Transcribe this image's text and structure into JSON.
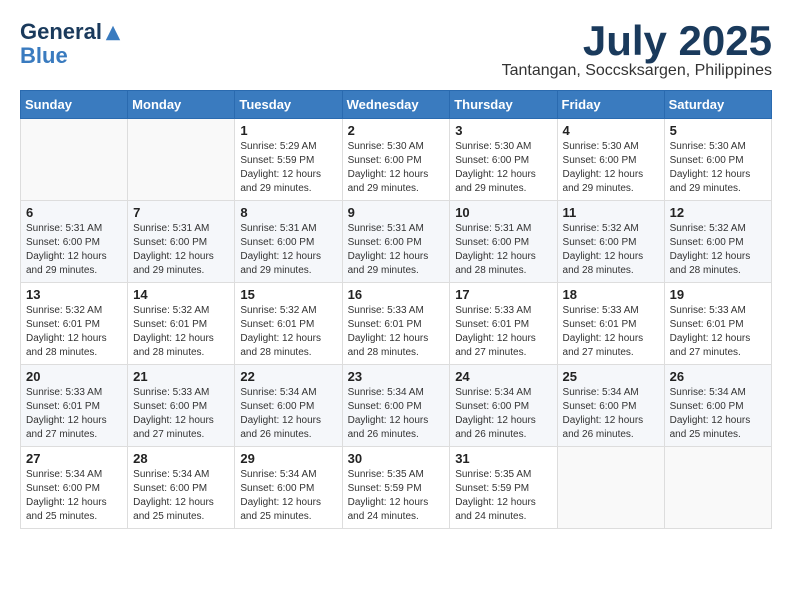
{
  "header": {
    "logo_line1": "General",
    "logo_line2": "Blue",
    "month_title": "July 2025",
    "location": "Tantangan, Soccsksargen, Philippines"
  },
  "weekdays": [
    "Sunday",
    "Monday",
    "Tuesday",
    "Wednesday",
    "Thursday",
    "Friday",
    "Saturday"
  ],
  "weeks": [
    [
      {
        "day": "",
        "info": ""
      },
      {
        "day": "",
        "info": ""
      },
      {
        "day": "1",
        "info": "Sunrise: 5:29 AM\nSunset: 5:59 PM\nDaylight: 12 hours and 29 minutes."
      },
      {
        "day": "2",
        "info": "Sunrise: 5:30 AM\nSunset: 6:00 PM\nDaylight: 12 hours and 29 minutes."
      },
      {
        "day": "3",
        "info": "Sunrise: 5:30 AM\nSunset: 6:00 PM\nDaylight: 12 hours and 29 minutes."
      },
      {
        "day": "4",
        "info": "Sunrise: 5:30 AM\nSunset: 6:00 PM\nDaylight: 12 hours and 29 minutes."
      },
      {
        "day": "5",
        "info": "Sunrise: 5:30 AM\nSunset: 6:00 PM\nDaylight: 12 hours and 29 minutes."
      }
    ],
    [
      {
        "day": "6",
        "info": "Sunrise: 5:31 AM\nSunset: 6:00 PM\nDaylight: 12 hours and 29 minutes."
      },
      {
        "day": "7",
        "info": "Sunrise: 5:31 AM\nSunset: 6:00 PM\nDaylight: 12 hours and 29 minutes."
      },
      {
        "day": "8",
        "info": "Sunrise: 5:31 AM\nSunset: 6:00 PM\nDaylight: 12 hours and 29 minutes."
      },
      {
        "day": "9",
        "info": "Sunrise: 5:31 AM\nSunset: 6:00 PM\nDaylight: 12 hours and 29 minutes."
      },
      {
        "day": "10",
        "info": "Sunrise: 5:31 AM\nSunset: 6:00 PM\nDaylight: 12 hours and 28 minutes."
      },
      {
        "day": "11",
        "info": "Sunrise: 5:32 AM\nSunset: 6:00 PM\nDaylight: 12 hours and 28 minutes."
      },
      {
        "day": "12",
        "info": "Sunrise: 5:32 AM\nSunset: 6:00 PM\nDaylight: 12 hours and 28 minutes."
      }
    ],
    [
      {
        "day": "13",
        "info": "Sunrise: 5:32 AM\nSunset: 6:01 PM\nDaylight: 12 hours and 28 minutes."
      },
      {
        "day": "14",
        "info": "Sunrise: 5:32 AM\nSunset: 6:01 PM\nDaylight: 12 hours and 28 minutes."
      },
      {
        "day": "15",
        "info": "Sunrise: 5:32 AM\nSunset: 6:01 PM\nDaylight: 12 hours and 28 minutes."
      },
      {
        "day": "16",
        "info": "Sunrise: 5:33 AM\nSunset: 6:01 PM\nDaylight: 12 hours and 28 minutes."
      },
      {
        "day": "17",
        "info": "Sunrise: 5:33 AM\nSunset: 6:01 PM\nDaylight: 12 hours and 27 minutes."
      },
      {
        "day": "18",
        "info": "Sunrise: 5:33 AM\nSunset: 6:01 PM\nDaylight: 12 hours and 27 minutes."
      },
      {
        "day": "19",
        "info": "Sunrise: 5:33 AM\nSunset: 6:01 PM\nDaylight: 12 hours and 27 minutes."
      }
    ],
    [
      {
        "day": "20",
        "info": "Sunrise: 5:33 AM\nSunset: 6:01 PM\nDaylight: 12 hours and 27 minutes."
      },
      {
        "day": "21",
        "info": "Sunrise: 5:33 AM\nSunset: 6:00 PM\nDaylight: 12 hours and 27 minutes."
      },
      {
        "day": "22",
        "info": "Sunrise: 5:34 AM\nSunset: 6:00 PM\nDaylight: 12 hours and 26 minutes."
      },
      {
        "day": "23",
        "info": "Sunrise: 5:34 AM\nSunset: 6:00 PM\nDaylight: 12 hours and 26 minutes."
      },
      {
        "day": "24",
        "info": "Sunrise: 5:34 AM\nSunset: 6:00 PM\nDaylight: 12 hours and 26 minutes."
      },
      {
        "day": "25",
        "info": "Sunrise: 5:34 AM\nSunset: 6:00 PM\nDaylight: 12 hours and 26 minutes."
      },
      {
        "day": "26",
        "info": "Sunrise: 5:34 AM\nSunset: 6:00 PM\nDaylight: 12 hours and 25 minutes."
      }
    ],
    [
      {
        "day": "27",
        "info": "Sunrise: 5:34 AM\nSunset: 6:00 PM\nDaylight: 12 hours and 25 minutes."
      },
      {
        "day": "28",
        "info": "Sunrise: 5:34 AM\nSunset: 6:00 PM\nDaylight: 12 hours and 25 minutes."
      },
      {
        "day": "29",
        "info": "Sunrise: 5:34 AM\nSunset: 6:00 PM\nDaylight: 12 hours and 25 minutes."
      },
      {
        "day": "30",
        "info": "Sunrise: 5:35 AM\nSunset: 5:59 PM\nDaylight: 12 hours and 24 minutes."
      },
      {
        "day": "31",
        "info": "Sunrise: 5:35 AM\nSunset: 5:59 PM\nDaylight: 12 hours and 24 minutes."
      },
      {
        "day": "",
        "info": ""
      },
      {
        "day": "",
        "info": ""
      }
    ]
  ]
}
